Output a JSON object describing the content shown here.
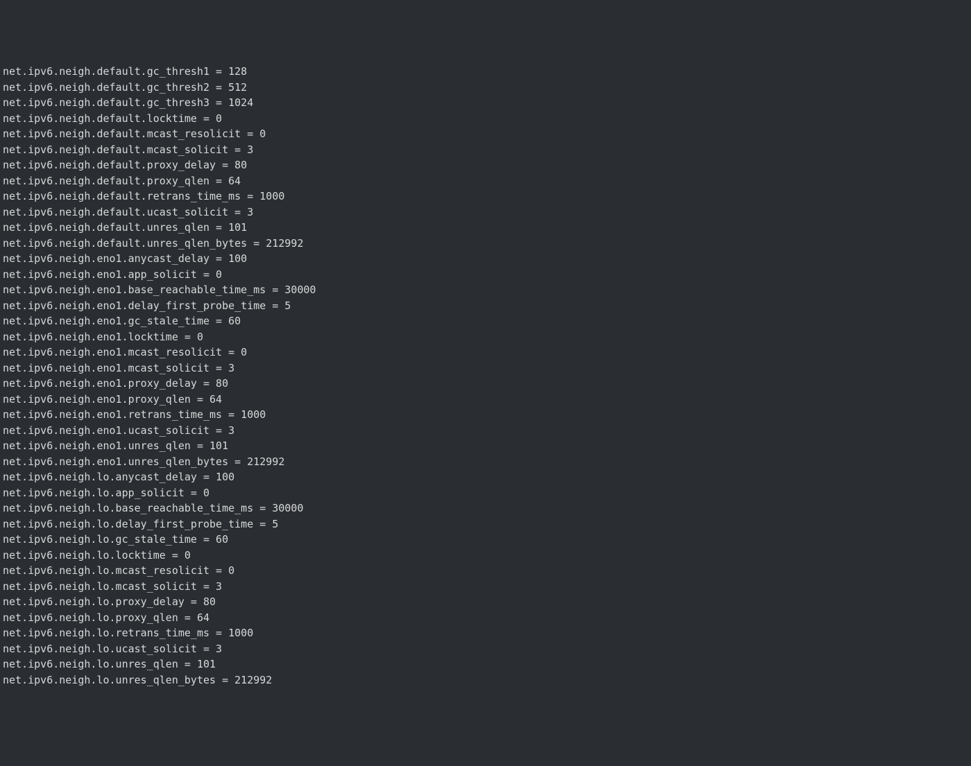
{
  "lines": [
    "net.ipv6.neigh.default.gc_thresh1 = 128",
    "net.ipv6.neigh.default.gc_thresh2 = 512",
    "net.ipv6.neigh.default.gc_thresh3 = 1024",
    "net.ipv6.neigh.default.locktime = 0",
    "net.ipv6.neigh.default.mcast_resolicit = 0",
    "net.ipv6.neigh.default.mcast_solicit = 3",
    "net.ipv6.neigh.default.proxy_delay = 80",
    "net.ipv6.neigh.default.proxy_qlen = 64",
    "net.ipv6.neigh.default.retrans_time_ms = 1000",
    "net.ipv6.neigh.default.ucast_solicit = 3",
    "net.ipv6.neigh.default.unres_qlen = 101",
    "net.ipv6.neigh.default.unres_qlen_bytes = 212992",
    "net.ipv6.neigh.eno1.anycast_delay = 100",
    "net.ipv6.neigh.eno1.app_solicit = 0",
    "net.ipv6.neigh.eno1.base_reachable_time_ms = 30000",
    "net.ipv6.neigh.eno1.delay_first_probe_time = 5",
    "net.ipv6.neigh.eno1.gc_stale_time = 60",
    "net.ipv6.neigh.eno1.locktime = 0",
    "net.ipv6.neigh.eno1.mcast_resolicit = 0",
    "net.ipv6.neigh.eno1.mcast_solicit = 3",
    "net.ipv6.neigh.eno1.proxy_delay = 80",
    "net.ipv6.neigh.eno1.proxy_qlen = 64",
    "net.ipv6.neigh.eno1.retrans_time_ms = 1000",
    "net.ipv6.neigh.eno1.ucast_solicit = 3",
    "net.ipv6.neigh.eno1.unres_qlen = 101",
    "net.ipv6.neigh.eno1.unres_qlen_bytes = 212992",
    "net.ipv6.neigh.lo.anycast_delay = 100",
    "net.ipv6.neigh.lo.app_solicit = 0",
    "net.ipv6.neigh.lo.base_reachable_time_ms = 30000",
    "net.ipv6.neigh.lo.delay_first_probe_time = 5",
    "net.ipv6.neigh.lo.gc_stale_time = 60",
    "net.ipv6.neigh.lo.locktime = 0",
    "net.ipv6.neigh.lo.mcast_resolicit = 0",
    "net.ipv6.neigh.lo.mcast_solicit = 3",
    "net.ipv6.neigh.lo.proxy_delay = 80",
    "net.ipv6.neigh.lo.proxy_qlen = 64",
    "net.ipv6.neigh.lo.retrans_time_ms = 1000",
    "net.ipv6.neigh.lo.ucast_solicit = 3",
    "net.ipv6.neigh.lo.unres_qlen = 101",
    "net.ipv6.neigh.lo.unres_qlen_bytes = 212992"
  ]
}
